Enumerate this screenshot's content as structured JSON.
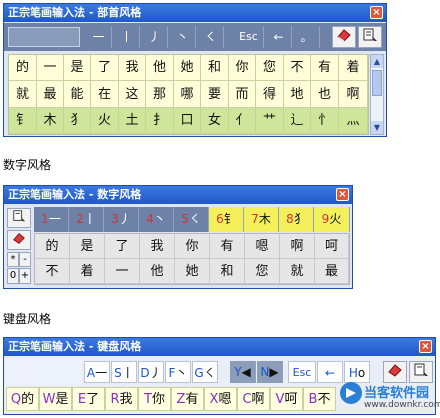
{
  "window1": {
    "title": "正宗笔画输入法 - 部首风格",
    "close": "×",
    "strokes": [
      "一",
      "丨",
      "丿",
      "丶",
      "㇛"
    ],
    "esc": "Esc",
    "back": "←",
    "dot": "。",
    "rows": [
      [
        "的",
        "一",
        "是",
        "了",
        "我",
        "他",
        "她",
        "和",
        "你",
        "您",
        "不",
        "有",
        "着"
      ],
      [
        "就",
        "最",
        "能",
        "在",
        "这",
        "那",
        "哪",
        "要",
        "而",
        "得",
        "地",
        "也",
        "啊"
      ]
    ],
    "radicals": [
      "钅",
      "木",
      "犭",
      "火",
      "土",
      "扌",
      "口",
      "女",
      "亻",
      "艹",
      "辶",
      "忄",
      "灬"
    ]
  },
  "caption1": "数字风格",
  "window2": {
    "title": "正宗笔画输入法 - 数字风格",
    "close": "×",
    "stroke_keys": [
      {
        "num": "1",
        "glyph": "一"
      },
      {
        "num": "2",
        "glyph": "丨"
      },
      {
        "num": "3",
        "glyph": "丿"
      },
      {
        "num": "4",
        "glyph": "丶"
      },
      {
        "num": "5",
        "glyph": "㇛"
      }
    ],
    "radical_keys": [
      {
        "num": "6",
        "glyph": "钅"
      },
      {
        "num": "7",
        "glyph": "木"
      },
      {
        "num": "8",
        "glyph": "犭"
      },
      {
        "num": "9",
        "glyph": "火"
      }
    ],
    "rows": [
      [
        "的",
        "是",
        "了",
        "我",
        "你",
        "有",
        "嗯",
        "啊",
        "呵"
      ],
      [
        "不",
        "着",
        "一",
        "他",
        "她",
        "和",
        "您",
        "就",
        "最"
      ]
    ],
    "small_keys": [
      "*",
      "-",
      "0",
      "+"
    ]
  },
  "caption2": "键盘风格",
  "window3": {
    "title": "正宗笔画输入法 - 键盘风格",
    "close": "×",
    "keys": [
      {
        "key": "A",
        "glyph": "一"
      },
      {
        "key": "S",
        "glyph": "丨"
      },
      {
        "key": "D",
        "glyph": "丿"
      },
      {
        "key": "F",
        "glyph": "丶"
      },
      {
        "key": "G",
        "glyph": "㇛"
      }
    ],
    "nav_keys": [
      {
        "key": "Y",
        "glyph": "◀"
      },
      {
        "key": "N",
        "glyph": "▶"
      }
    ],
    "esc": "Esc",
    "back_key": "←",
    "h_key": {
      "key": "H",
      "glyph": "o"
    },
    "candidates": [
      {
        "key": "Q",
        "char": "的"
      },
      {
        "key": "W",
        "char": "是"
      },
      {
        "key": "E",
        "char": "了"
      },
      {
        "key": "R",
        "char": "我"
      },
      {
        "key": "T",
        "char": "你"
      },
      {
        "key": "Z",
        "char": "有"
      },
      {
        "key": "X",
        "char": "嗯"
      },
      {
        "key": "C",
        "char": "啊"
      },
      {
        "key": "V",
        "char": "呵"
      },
      {
        "key": "B",
        "char": "不"
      }
    ]
  },
  "watermark": {
    "brand": "当客软件园",
    "url": "www.downkr.com"
  }
}
